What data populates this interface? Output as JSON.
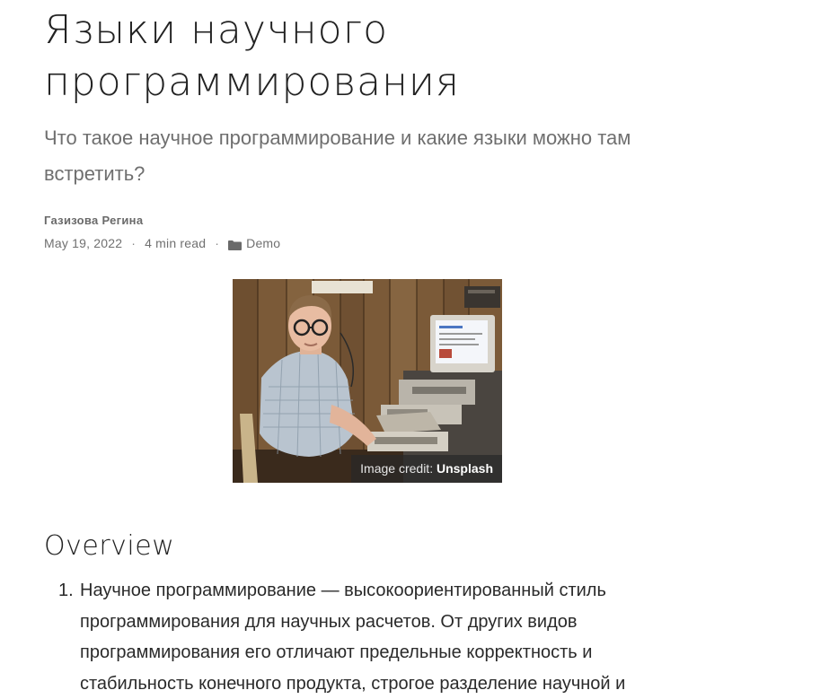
{
  "article": {
    "title_line1": "Языки научного",
    "title_line2": "программирования",
    "subtitle": "Что такое научное программирование и какие языки можно там встретить?",
    "author": "Газизова Регина",
    "date": "May 19, 2022",
    "separator": "·",
    "read_time": "4 min read",
    "category": "Demo",
    "category_icon": "folder-icon"
  },
  "figure": {
    "credit_prefix": "Image credit:",
    "credit_source": "Unsplash"
  },
  "overview": {
    "heading": "Overview",
    "items": [
      {
        "number": "1.",
        "text": "Научное программирование — высокоориентированный стиль программирования для научных расчетов. От других видов программирования его отличают предельные корректность и стабильность конечного продукта, строгое разделение научной и"
      }
    ]
  }
}
